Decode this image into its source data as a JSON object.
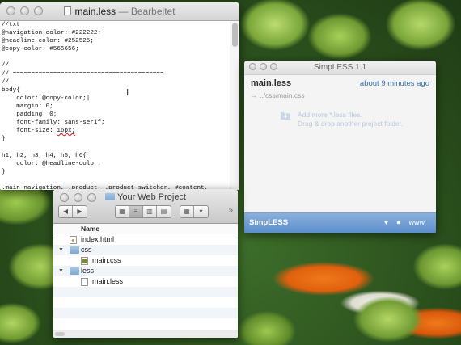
{
  "editor": {
    "title_name": "main.less",
    "title_sep": " — ",
    "title_state": "Bearbeitet",
    "lines": [
      "//txt",
      "@navigation-color: #222222;",
      "@headline-color: #252525;",
      "@copy-color: #565656;",
      "",
      "//",
      "// =========================================",
      "//",
      "body{",
      "    color: @copy-color;|",
      "    margin: 0;",
      "    padding: 0;",
      "    font-family: sans-serif;",
      "    font-size: ",
      "}",
      "",
      "h1, h2, h3, h4, h5, h6{",
      "    color: @headline-color;",
      "}",
      "",
      ".main-navigation, .product, .product-switcher, #content,"
    ],
    "font_size_value": "16px;"
  },
  "simpless": {
    "title": "SimpLESS 1.1",
    "project_name": "main.less",
    "project_time": "about 9 minutes ago",
    "project_path": "→ ../css/main.css",
    "drop_line1": "Add more *.less files.",
    "drop_line2": "Drag & drop another project folder.",
    "footer_brand": "SimpLESS",
    "footer_icons": [
      "heart-icon",
      "speech-bubble-icon",
      "www-link"
    ],
    "footer_www": "www"
  },
  "finder": {
    "title": "Your Web Project",
    "column_name": "Name",
    "items": [
      {
        "name": "index.html",
        "kind": "html",
        "indent": 0,
        "disclosure": ""
      },
      {
        "name": "css",
        "kind": "folder",
        "indent": 0,
        "disclosure": "▼"
      },
      {
        "name": "main.css",
        "kind": "css",
        "indent": 1,
        "disclosure": ""
      },
      {
        "name": "less",
        "kind": "folder",
        "indent": 0,
        "disclosure": "▼"
      },
      {
        "name": "main.less",
        "kind": "less",
        "indent": 1,
        "disclosure": ""
      }
    ]
  },
  "colors": {
    "simpless_footer": "#6f9ad0",
    "simpless_accent": "#3b6fb3",
    "spell_error": "#dd1111"
  }
}
